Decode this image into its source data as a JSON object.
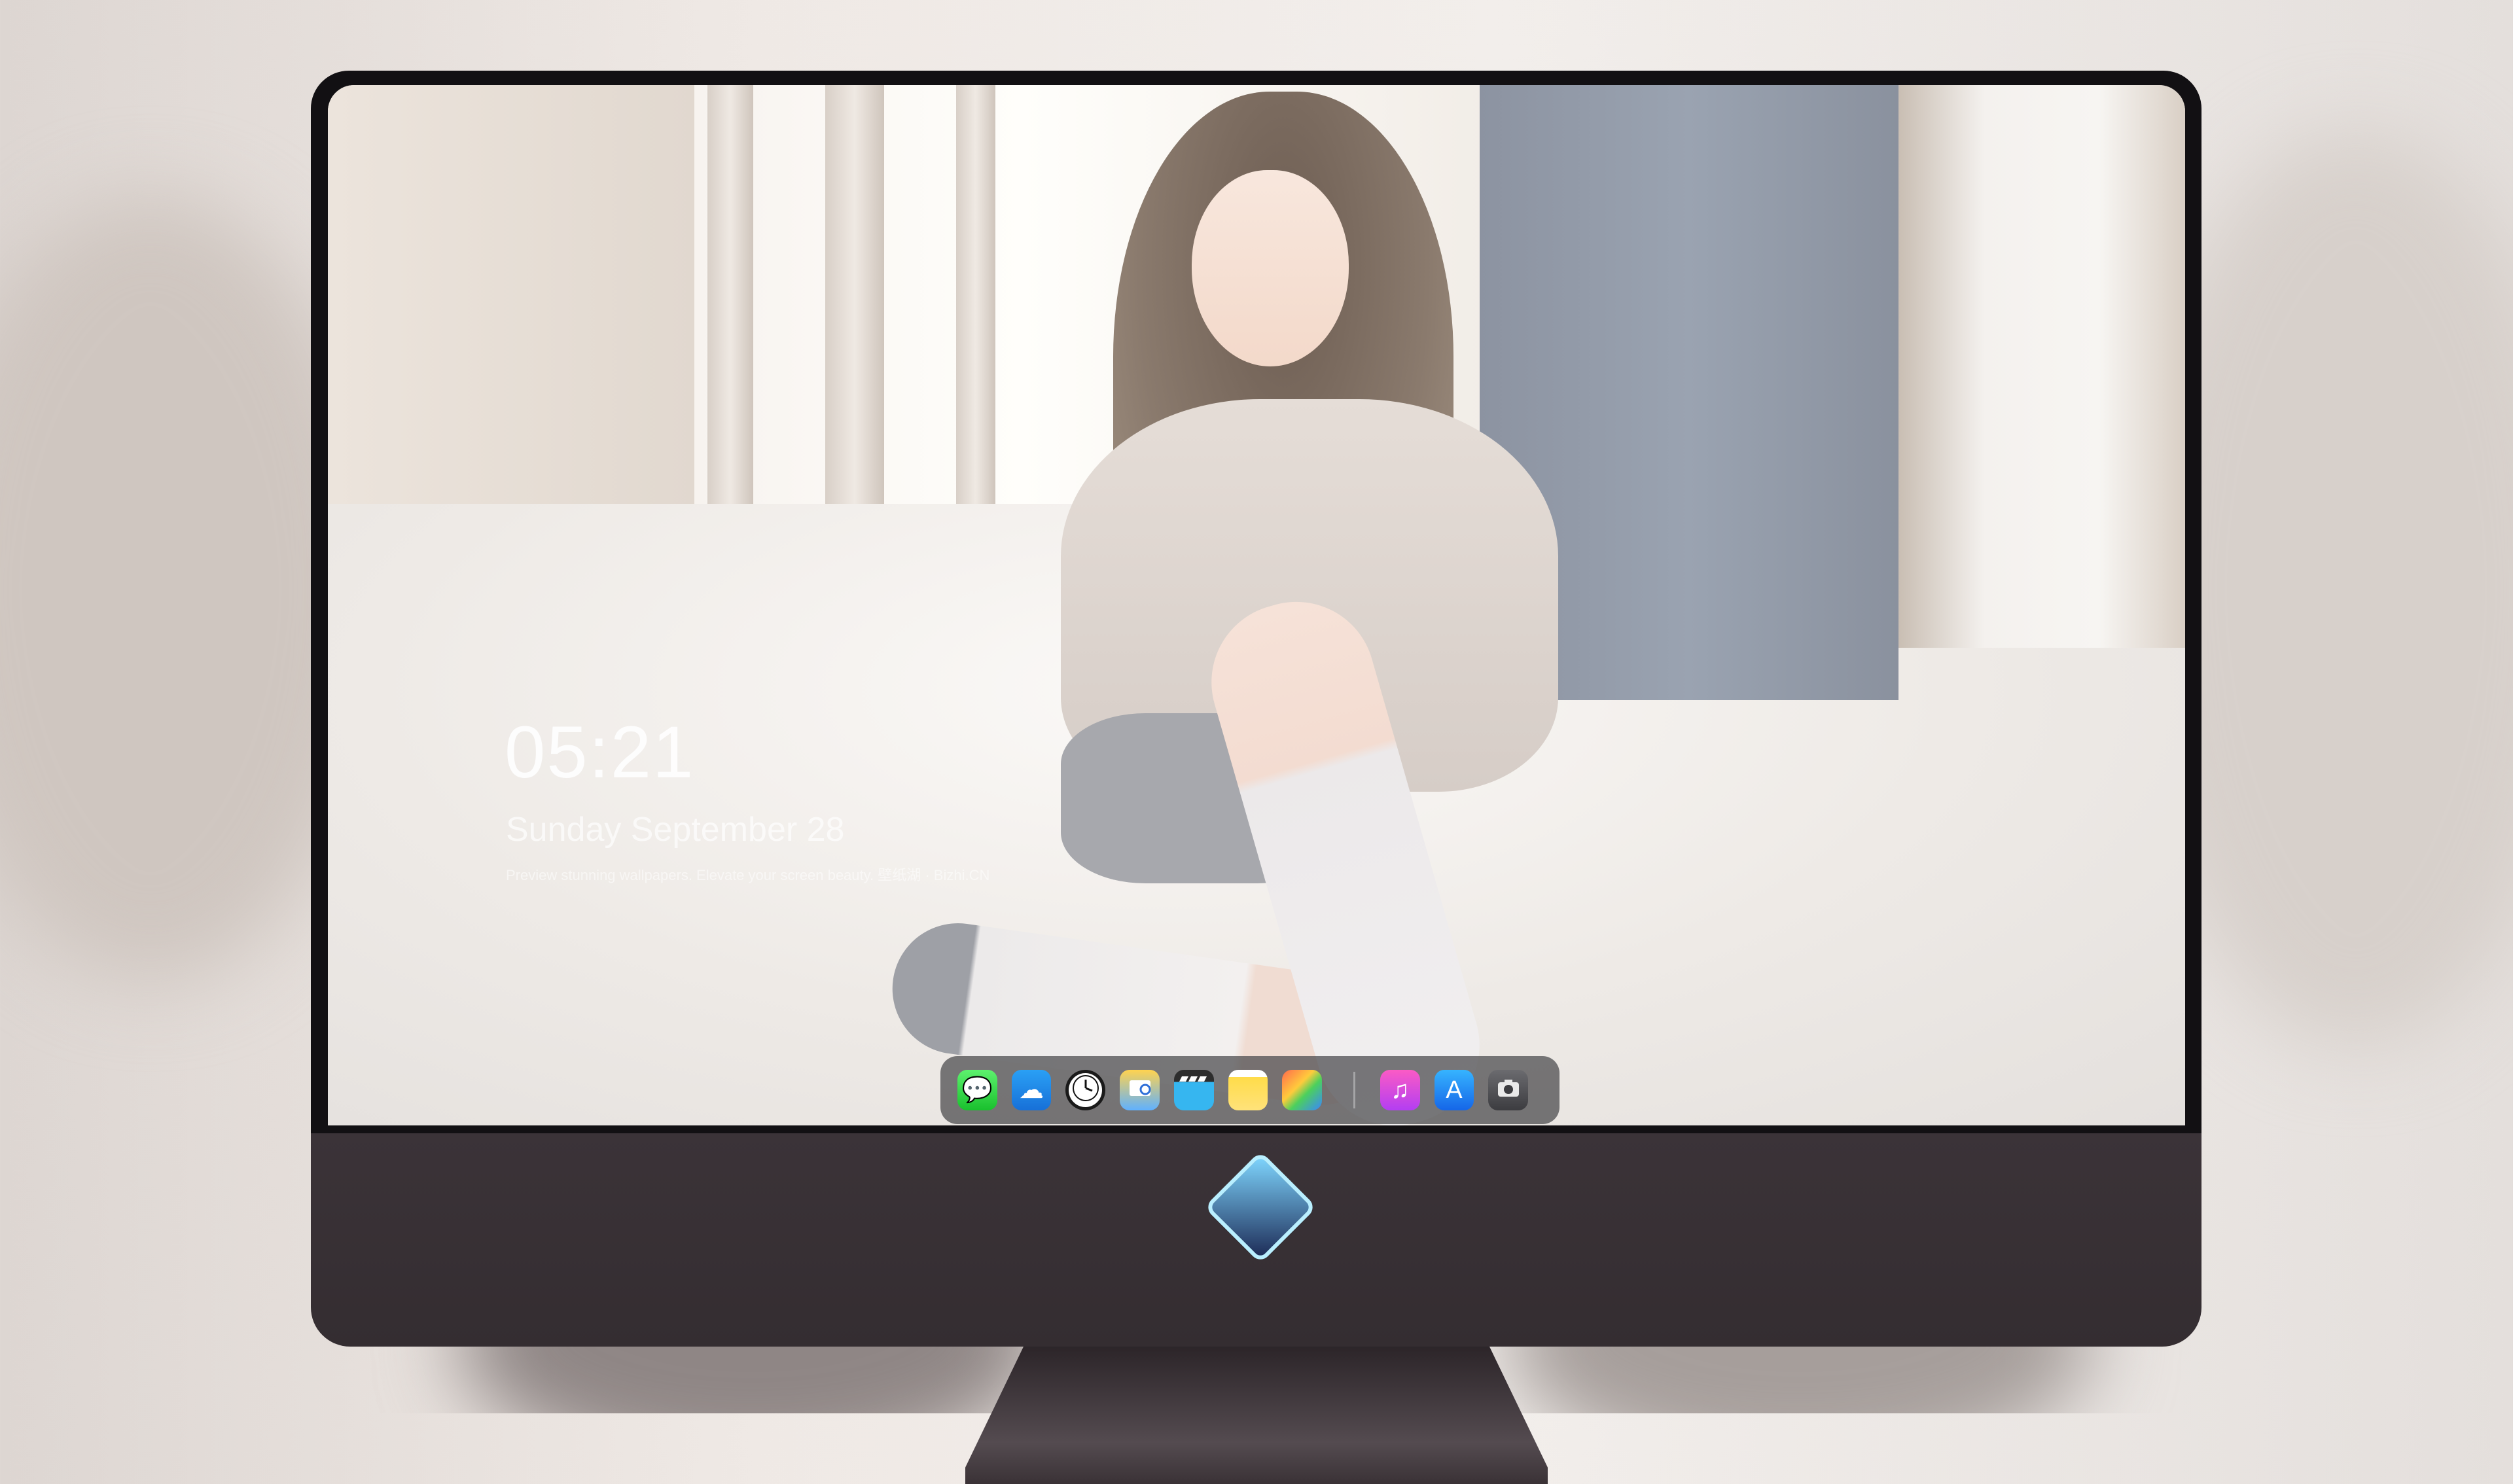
{
  "lockscreen": {
    "time": "05:21",
    "date": "Sunday September 28",
    "tagline": "Preview stunning wallpapers. Elevate your screen beauty. 壁纸湖 · Bizhi.CN"
  },
  "dock": {
    "apps": [
      {
        "label": "Messages",
        "icon": "message-bubble-icon",
        "glyph": "💬"
      },
      {
        "label": "Weather",
        "icon": "cloud-icon",
        "glyph": "☁"
      },
      {
        "label": "Clock",
        "icon": "clock-icon",
        "glyph": "🕐"
      },
      {
        "label": "Preview",
        "icon": "preview-icon",
        "glyph": "🖼"
      },
      {
        "label": "Video",
        "icon": "clapper-icon",
        "glyph": "🎬"
      },
      {
        "label": "Notes",
        "icon": "notes-icon",
        "glyph": "≡"
      },
      {
        "label": "Photos",
        "icon": "photos-icon",
        "glyph": "✿"
      },
      {
        "label": "Music",
        "icon": "music-note-icon",
        "glyph": "♫"
      },
      {
        "label": "App Store",
        "icon": "app-store-icon",
        "glyph": "A"
      },
      {
        "label": "Camera",
        "icon": "camera-icon",
        "glyph": "📷"
      }
    ]
  },
  "colors": {
    "bezel": "#121013",
    "chin": "#3b3338",
    "dock_bg": "rgba(70,70,74,.72)",
    "text": "#ffffff"
  }
}
